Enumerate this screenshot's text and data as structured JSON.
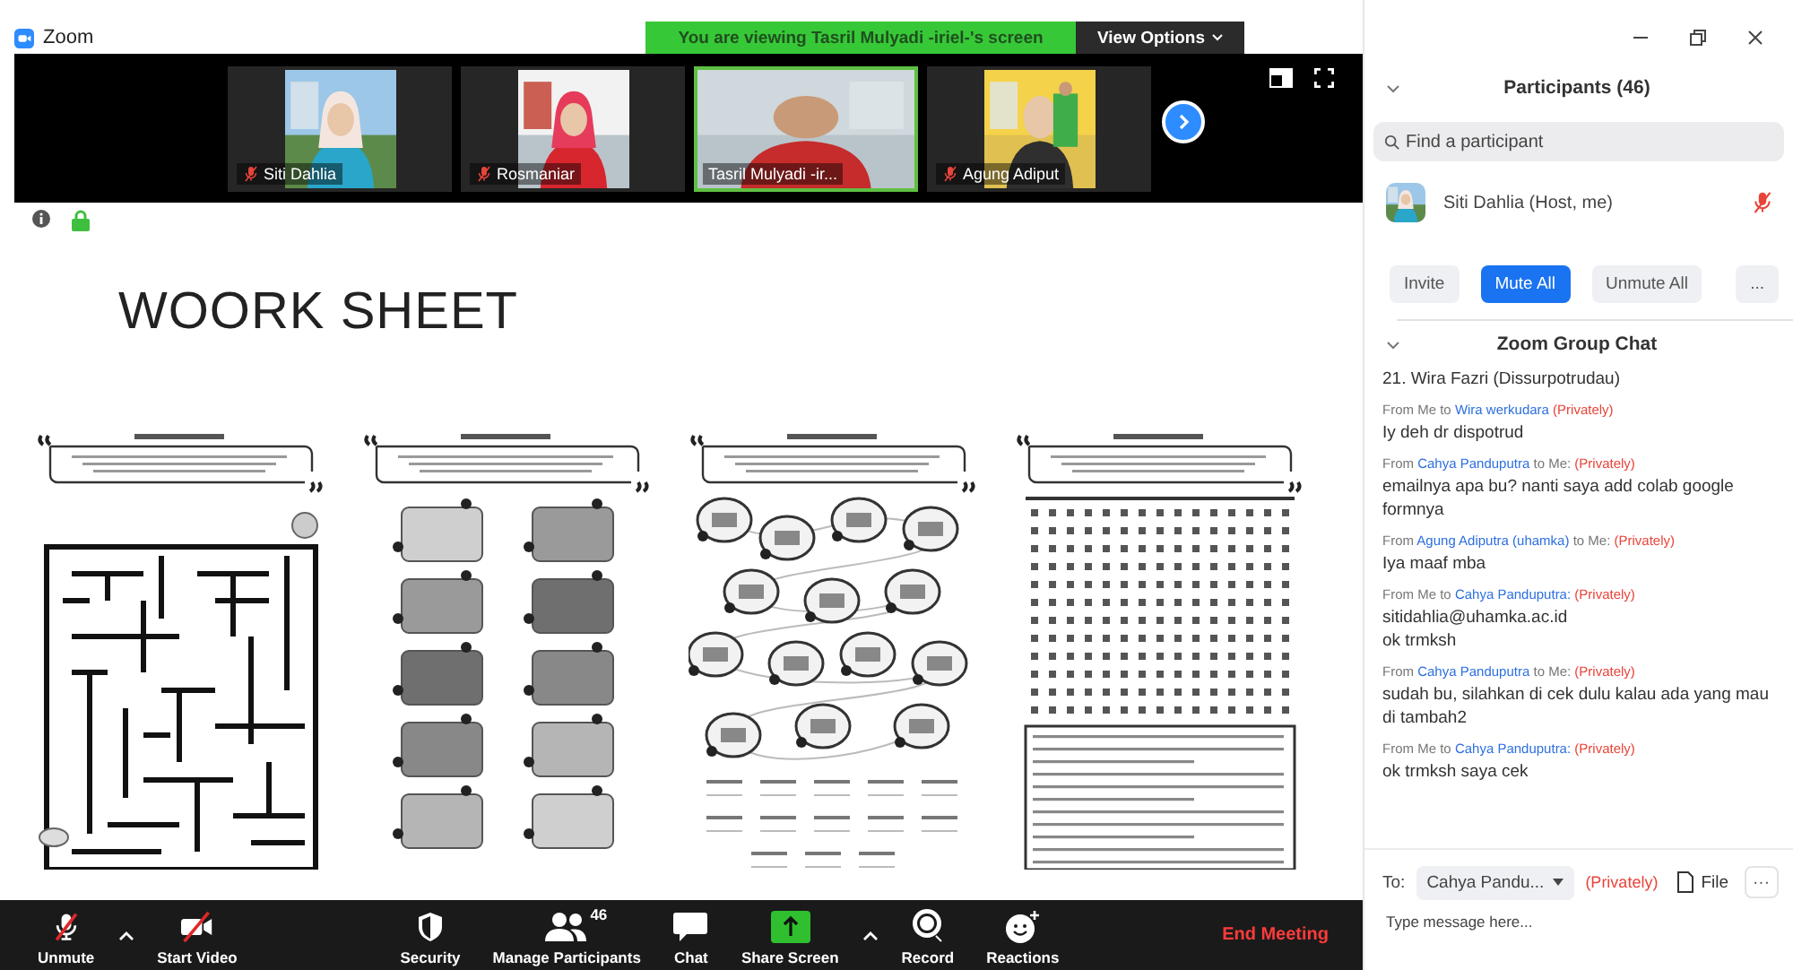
{
  "window": {
    "title": "Zoom"
  },
  "share_banner": {
    "text": "You are viewing Tasril Mulyadi -iriel-'s screen",
    "button": "View Options"
  },
  "video_strip": {
    "tiles": [
      {
        "name": "Siti Dahlia",
        "muted": true,
        "selected": false
      },
      {
        "name": "Rosmaniar",
        "muted": true,
        "selected": false
      },
      {
        "name": "Tasril Mulyadi -ir...",
        "muted": false,
        "selected": true
      },
      {
        "name": "Agung Adiput",
        "muted": true,
        "selected": false
      }
    ]
  },
  "shared_screen": {
    "title": "WOORK SHEET",
    "pages": [
      {
        "kind": "maze"
      },
      {
        "kind": "matching"
      },
      {
        "kind": "clouds"
      },
      {
        "kind": "wordsearch"
      }
    ]
  },
  "toolbar": {
    "items": [
      {
        "kind": "mic",
        "label": "Unmute",
        "off": true
      },
      {
        "kind": "caret"
      },
      {
        "kind": "video",
        "label": "Start Video",
        "off": true
      },
      {
        "kind": "spacer"
      },
      {
        "kind": "security",
        "label": "Security"
      },
      {
        "kind": "participants",
        "label": "Manage Participants",
        "count": "46"
      },
      {
        "kind": "chat",
        "label": "Chat"
      },
      {
        "kind": "share",
        "label": "Share Screen"
      },
      {
        "kind": "caret"
      },
      {
        "kind": "record",
        "label": "Record"
      },
      {
        "kind": "reactions",
        "label": "Reactions"
      },
      {
        "kind": "spacer"
      },
      {
        "kind": "end",
        "label": "End Meeting"
      }
    ]
  },
  "participants": {
    "title": "Participants (46)",
    "search_placeholder": "Find a participant",
    "list": [
      {
        "name": "Siti Dahlia (Host, me)",
        "muted": true
      }
    ],
    "buttons": [
      {
        "label": "Invite",
        "primary": false
      },
      {
        "label": "Mute All",
        "primary": true
      },
      {
        "label": "Unmute All",
        "primary": false
      },
      {
        "label": "...",
        "primary": false
      }
    ]
  },
  "chat": {
    "title": "Zoom Group Chat",
    "messages": [
      {
        "lines": [
          "21. Wira Fazri (Dissurpotrudau)"
        ]
      },
      {
        "header": [
          {
            "text": "From Me to",
            "kind": "plain"
          },
          {
            "text": "Wira werkudara",
            "kind": "name"
          },
          {
            "text": "(Privately)",
            "kind": "private"
          }
        ],
        "lines": [
          "Iy deh dr dispotrud"
        ]
      },
      {
        "header": [
          {
            "text": "From",
            "kind": "plain"
          },
          {
            "text": "Cahya Panduputra",
            "kind": "name"
          },
          {
            "text": "to Me:",
            "kind": "plain"
          },
          {
            "text": "(Privately)",
            "kind": "private"
          }
        ],
        "lines": [
          "emailnya apa bu? nanti saya add colab google formnya"
        ]
      },
      {
        "header": [
          {
            "text": "From",
            "kind": "plain"
          },
          {
            "text": "Agung Adiputra (uhamka)",
            "kind": "name"
          },
          {
            "text": "to Me:",
            "kind": "plain"
          },
          {
            "text": "(Privately)",
            "kind": "private"
          }
        ],
        "lines": [
          "Iya maaf mba"
        ]
      },
      {
        "header": [
          {
            "text": "From Me to",
            "kind": "plain"
          },
          {
            "text": "Cahya Panduputra:",
            "kind": "name"
          },
          {
            "text": "(Privately)",
            "kind": "private"
          }
        ],
        "lines": [
          "sitidahlia@uhamka.ac.id",
          "ok trmksh"
        ]
      },
      {
        "header": [
          {
            "text": "From",
            "kind": "plain"
          },
          {
            "text": "Cahya Panduputra",
            "kind": "name"
          },
          {
            "text": "to Me:",
            "kind": "plain"
          },
          {
            "text": "(Privately)",
            "kind": "private"
          }
        ],
        "lines": [
          "sudah bu, silahkan di cek dulu kalau ada yang mau di tambah2"
        ]
      },
      {
        "header": [
          {
            "text": "From Me to",
            "kind": "plain"
          },
          {
            "text": "Cahya Panduputra:",
            "kind": "name"
          },
          {
            "text": "(Privately)",
            "kind": "private"
          }
        ],
        "lines": [
          "ok trmksh saya cek"
        ]
      }
    ],
    "compose": {
      "to_label": "To:",
      "recipient": "Cahya Pandu...",
      "privacy": "(Privately)",
      "file": "File",
      "more": "···",
      "placeholder": "Type message here..."
    }
  }
}
